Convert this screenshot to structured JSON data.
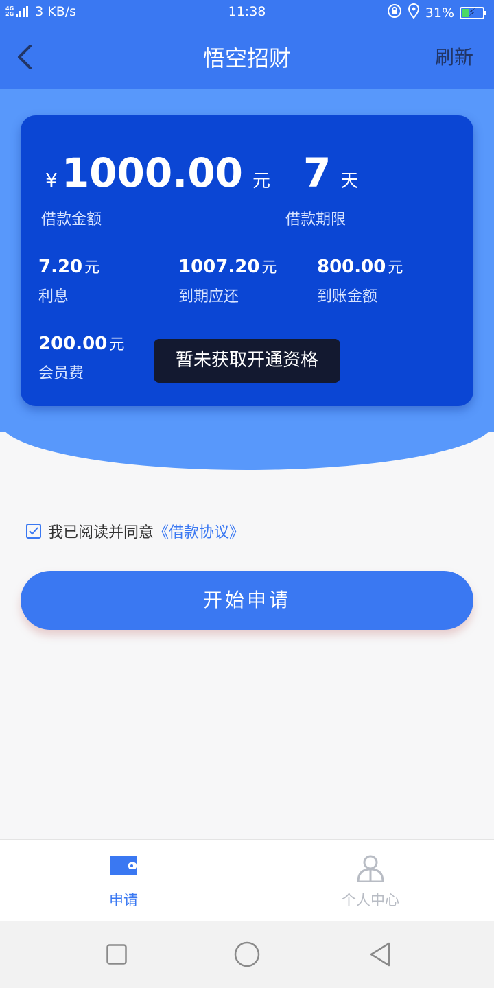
{
  "status_bar": {
    "net_badge_top": "4G",
    "net_badge_bottom": "2G",
    "speed": "3 KB/s",
    "time": "11:38",
    "battery": "31%"
  },
  "navbar": {
    "title": "悟空招财",
    "refresh_label": "刷新"
  },
  "loan_card": {
    "currency_symbol": "¥",
    "amount": "1000.00",
    "amount_unit": "元",
    "amount_label": "借款金额",
    "term": "7",
    "term_unit": "天",
    "term_label": "借款期限",
    "stats": [
      {
        "value": "7.20",
        "unit": "元",
        "label": "利息"
      },
      {
        "value": "1007.20",
        "unit": "元",
        "label": "到期应还"
      },
      {
        "value": "800.00",
        "unit": "元",
        "label": "到账金额"
      },
      {
        "value": "200.00",
        "unit": "元",
        "label": "会员费"
      }
    ]
  },
  "toast": {
    "message": "暂未获取开通资格"
  },
  "agreement": {
    "text": "我已阅读并同意",
    "link": "《借款协议》",
    "checked": true
  },
  "apply_button": {
    "label": "开始申请"
  },
  "tabbar": {
    "tabs": [
      {
        "label": "申请",
        "active": true
      },
      {
        "label": "个人中心",
        "active": false
      }
    ]
  },
  "colors": {
    "primary": "#3a78f2",
    "card": "#0b46d4",
    "hero": "#5898fb",
    "inactive": "#b8bcc4"
  }
}
